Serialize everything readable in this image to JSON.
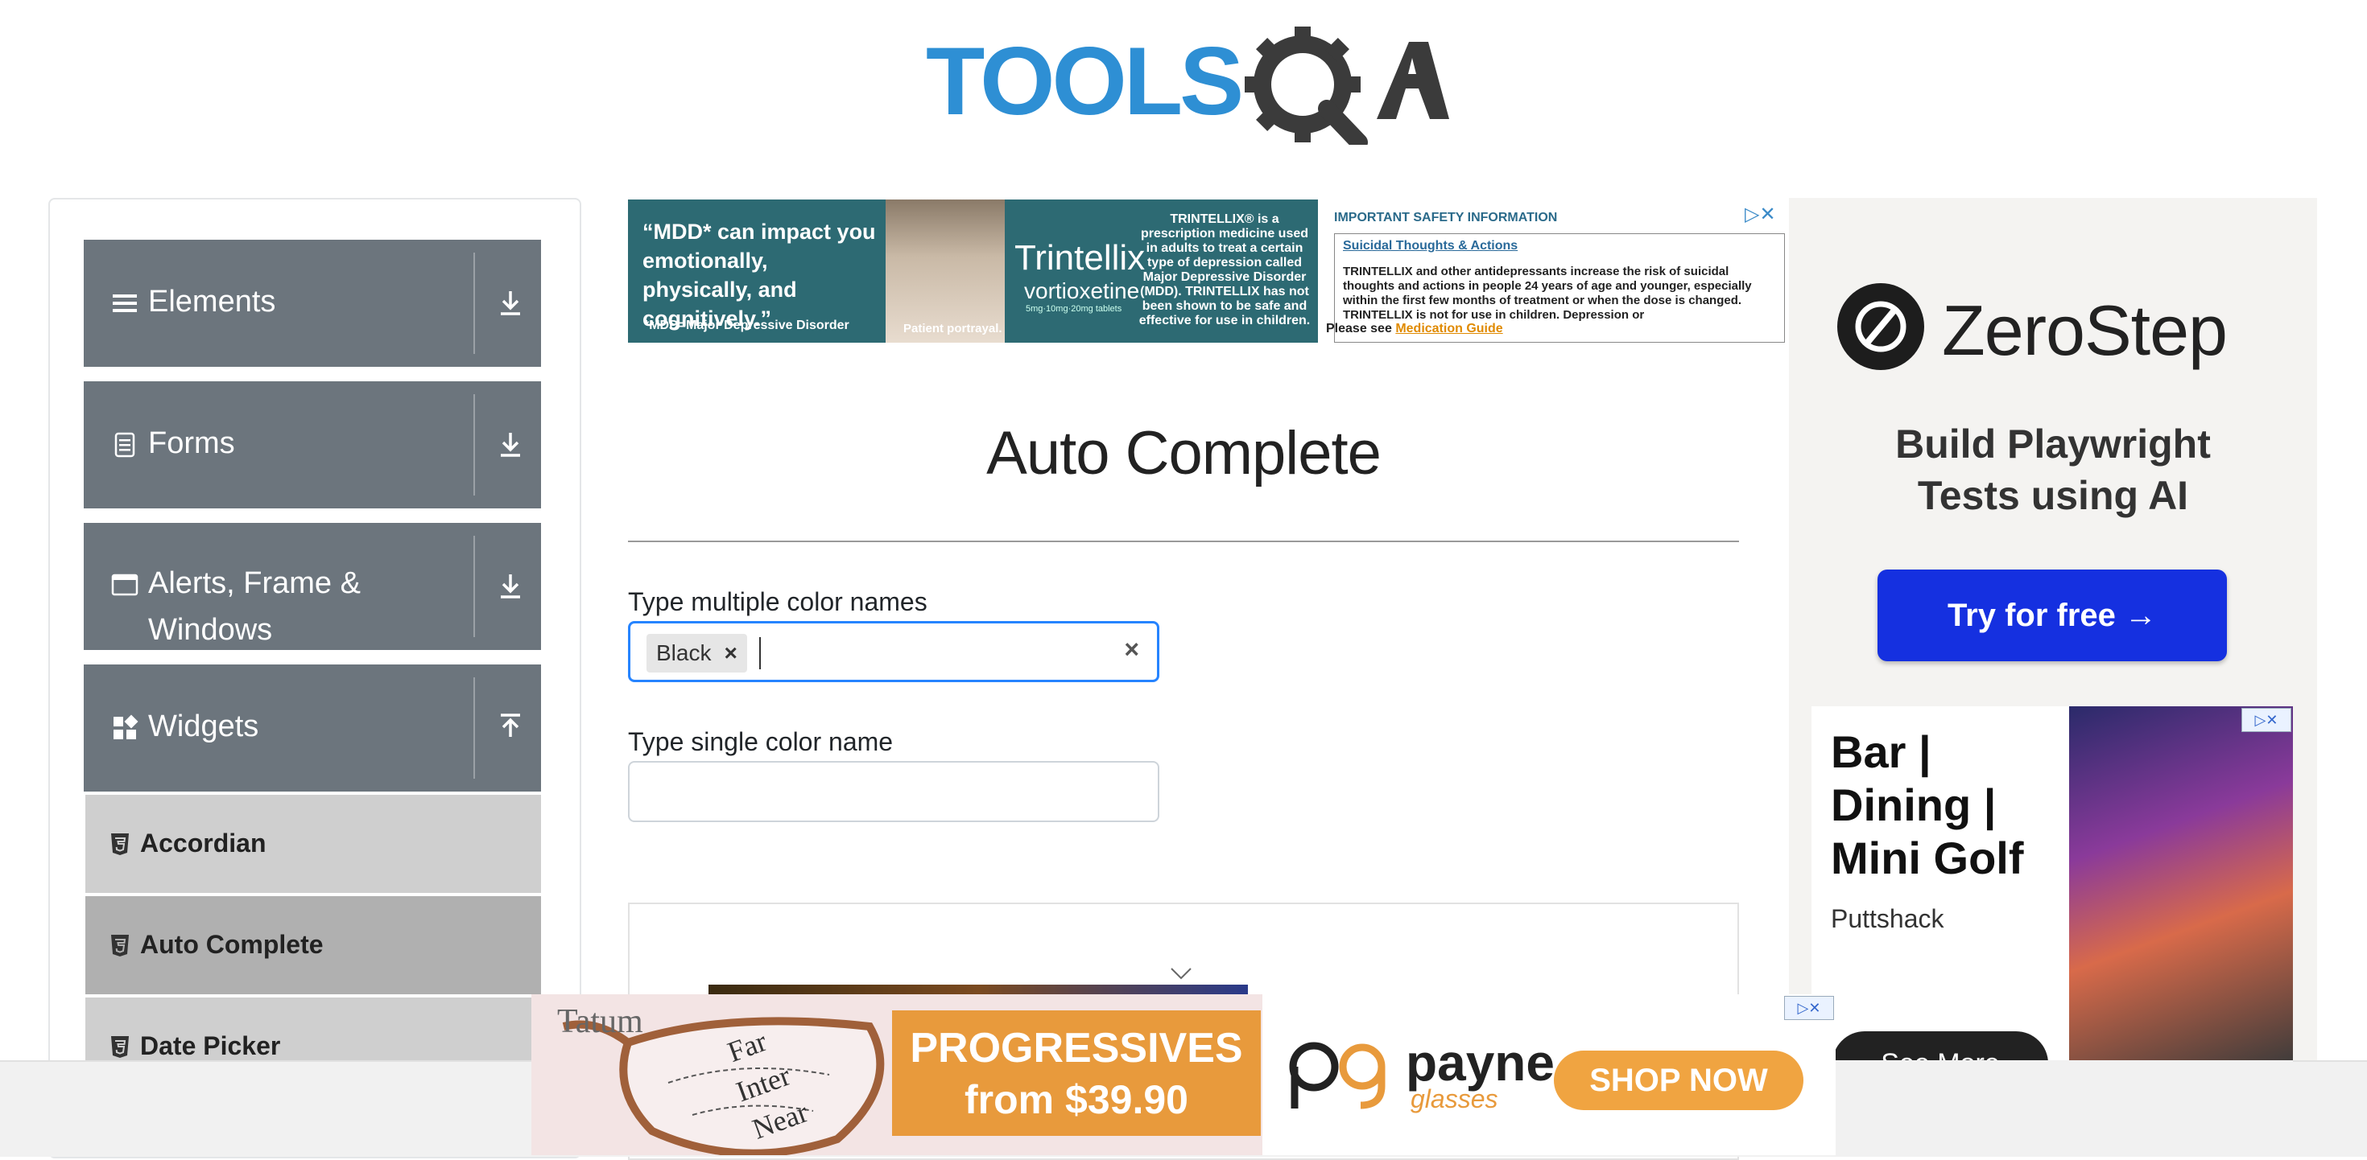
{
  "header": {
    "logo_text": "TOOLSQA"
  },
  "sidebar": {
    "groups": [
      {
        "label": "Elements",
        "icon": "hamburger-icon",
        "arrow": "download-icon"
      },
      {
        "label": "Forms",
        "icon": "document-icon",
        "arrow": "download-icon"
      },
      {
        "label_line1": "Alerts, Frame &",
        "label_line2": "Windows",
        "icon": "window-icon",
        "arrow": "download-icon"
      },
      {
        "label": "Widgets",
        "icon": "widgets-icon",
        "arrow": "upload-icon"
      }
    ],
    "widget_items": [
      {
        "label": "Accordian",
        "active": false
      },
      {
        "label": "Auto Complete",
        "active": true
      },
      {
        "label": "Date Picker",
        "active": false
      }
    ]
  },
  "top_ad": {
    "quote": "“MDD* can impact you emotionally, physically, and cognitively.”",
    "footnote": "*MDD=Major Depressive Disorder",
    "portrayal": "Patient portrayal.",
    "brand": "Trintellix",
    "generic": "vortioxetine",
    "dose": "5mg·10mg·20mg tablets",
    "description": "TRINTELLIX® is a prescription medicine used in adults to treat a certain type of depression called Major Depressive Disorder (MDD). TRINTELLIX has not been shown to be safe and effective for use in children.",
    "safety_title": "IMPORTANT SAFETY INFORMATION",
    "safety_subtitle": "Suicidal Thoughts & Actions",
    "safety_body": "TRINTELLIX and other antidepressants increase the risk of suicidal thoughts and actions in people 24 years of age and younger, especially within the first few months of treatment or when the dose is changed. TRINTELLIX is not for use in children. Depression or",
    "please_see": "Please see",
    "med_guide": "Medication Guide"
  },
  "main": {
    "title": "Auto Complete",
    "multi_label": "Type multiple color names",
    "multi_chip": "Black",
    "chip_remove": "×",
    "clear": "×",
    "single_label": "Type single color name",
    "single_value": ""
  },
  "right_ad": {
    "brand": "ZeroStep",
    "tagline": "Build Playwright Tests using AI",
    "cta": "Try for free →",
    "bar_headline": "Bar | Dining | Mini Golf",
    "bar_brand": "Puttshack",
    "bar_cta": "See More",
    "adchoices": "▷✕"
  },
  "bottom_ad": {
    "tatum": "Tatum",
    "lens_far": "Far",
    "lens_inter": "Inter",
    "lens_near": "Near",
    "offer_line1": "PROGRESSIVES",
    "offer_line2": "from $39.90",
    "payne": "payne",
    "payne_sub": "glasses",
    "cta": "SHOP NOW",
    "adchoices": "▷✕"
  },
  "colors": {
    "sidebar_header": "#6c757d",
    "sidebar_item": "#cfcfcf",
    "sidebar_item_active": "#b0b0b0",
    "focus_border": "#2684ff",
    "zerostep_cta": "#1530e0",
    "bottom_accent": "#e89a3c",
    "logo_blue": "#2e8fd4",
    "logo_dark": "#3b3b3b"
  }
}
